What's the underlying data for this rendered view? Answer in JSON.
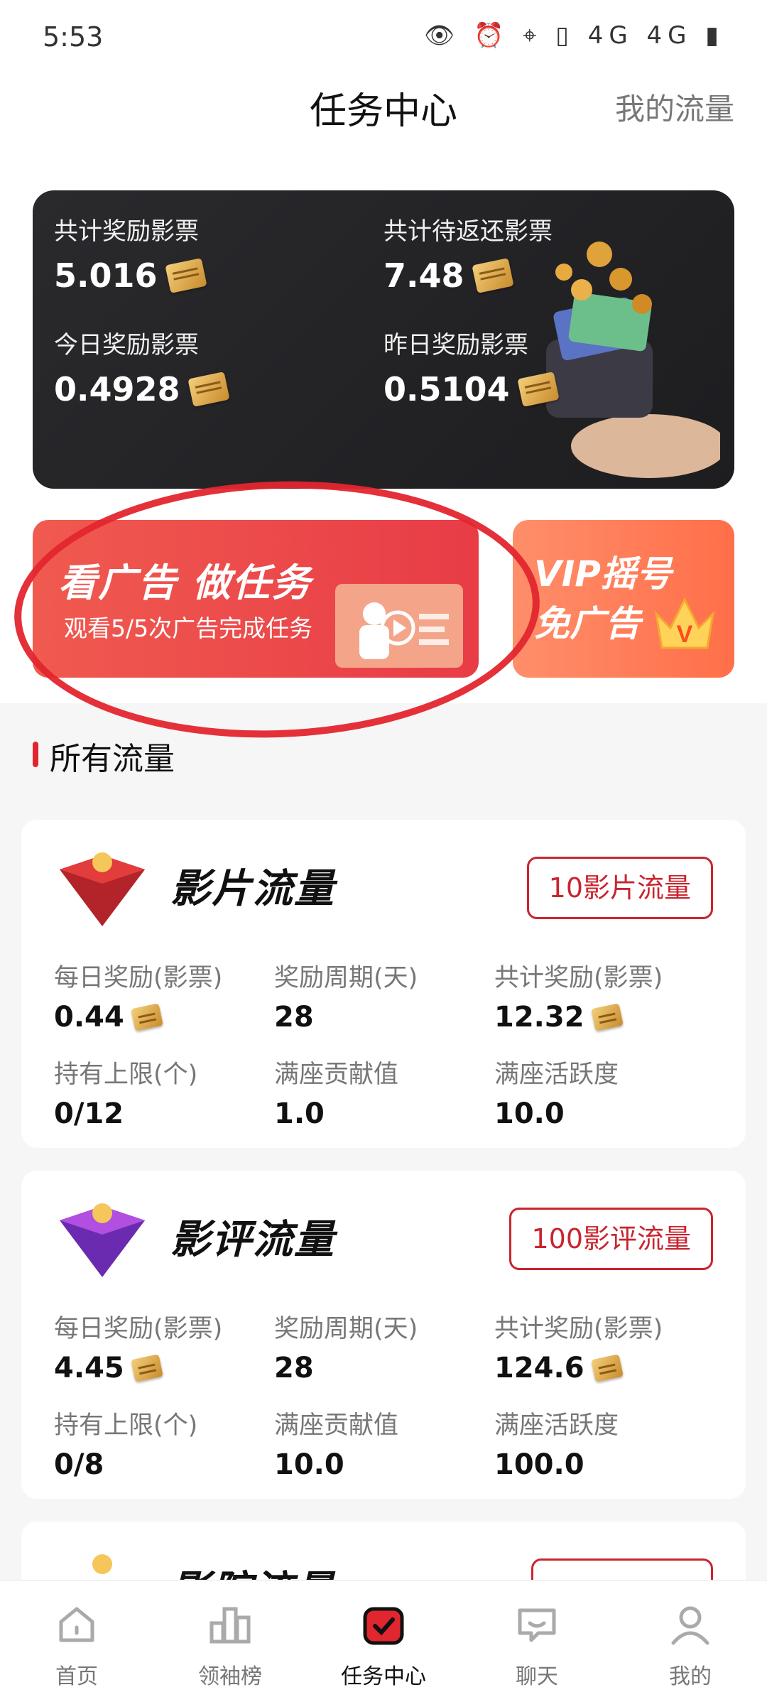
{
  "status_bar": {
    "time": "5:53",
    "icons": "👁 ⏰ ⌖ ▯ 4G 4G ▮"
  },
  "header": {
    "title": "任务中心",
    "right_link": "我的流量"
  },
  "stats": [
    {
      "label": "共计奖励影票",
      "value": "5.016"
    },
    {
      "label": "共计待返还影票",
      "value": "7.48"
    },
    {
      "label": "今日奖励影票",
      "value": "0.4928"
    },
    {
      "label": "昨日奖励影票",
      "value": "0.5104"
    }
  ],
  "banners": {
    "ad": {
      "title": "看广告 做任务",
      "subtitle": "观看5/5次广告完成任务"
    },
    "vip": {
      "line1": "VIP摇号",
      "line2": "免广告"
    }
  },
  "section": {
    "title": "所有流量"
  },
  "cards": [
    {
      "logo_text_top": "影 片",
      "logo_text_bottom": "流 量",
      "title": "影片流量",
      "button": "10影片流量",
      "metrics": [
        {
          "label": "每日奖励(影票)",
          "value": "0.44"
        },
        {
          "label": "奖励周期(天)",
          "value": "28"
        },
        {
          "label": "共计奖励(影票)",
          "value": "12.32"
        },
        {
          "label": "持有上限(个)",
          "value": "0/12"
        },
        {
          "label": "满座贡献值",
          "value": "1.0"
        },
        {
          "label": "满座活跃度",
          "value": "10.0"
        }
      ]
    },
    {
      "logo_text_top": "影 评",
      "logo_text_bottom": "流 量",
      "title": "影评流量",
      "button": "100影评流量",
      "metrics": [
        {
          "label": "每日奖励(影票)",
          "value": "4.45"
        },
        {
          "label": "奖励周期(天)",
          "value": "28"
        },
        {
          "label": "共计奖励(影票)",
          "value": "124.6"
        },
        {
          "label": "持有上限(个)",
          "value": "0/8"
        },
        {
          "label": "满座贡献值",
          "value": "10.0"
        },
        {
          "label": "满座活跃度",
          "value": "100.0"
        }
      ]
    },
    {
      "logo_text_top": "影 院",
      "title": "影院流量"
    }
  ],
  "tabs": [
    {
      "label": "首页",
      "icon": "home-icon"
    },
    {
      "label": "领袖榜",
      "icon": "leaderboard-icon"
    },
    {
      "label": "任务中心",
      "icon": "task-center-icon"
    },
    {
      "label": "聊天",
      "icon": "chat-icon"
    },
    {
      "label": "我的",
      "icon": "profile-icon"
    }
  ],
  "colors": {
    "accent": "#e0262e",
    "dark_card": "#232326",
    "vip": "#ff7b55"
  }
}
